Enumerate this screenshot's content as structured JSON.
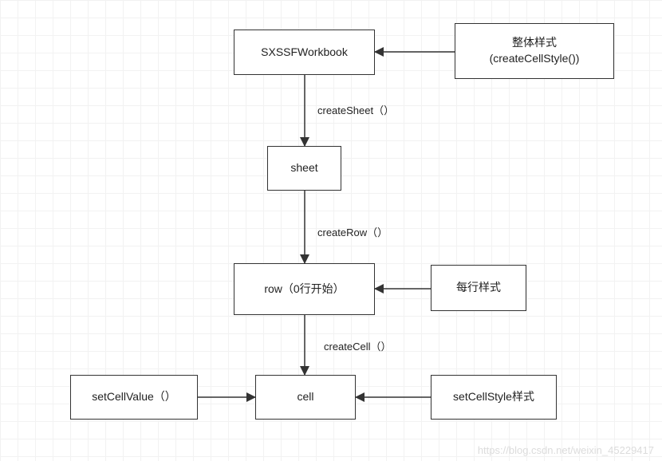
{
  "nodes": {
    "workbook": {
      "label": "SXSSFWorkbook"
    },
    "globalStyle": {
      "label": "整体样式\n(createCellStyle())"
    },
    "sheet": {
      "label": "sheet"
    },
    "row": {
      "label": "row（0行开始）"
    },
    "rowStyle": {
      "label": "每行样式"
    },
    "cell": {
      "label": "cell"
    },
    "setValue": {
      "label": "setCellValue（）"
    },
    "setStyle": {
      "label": "setCellStyle样式"
    }
  },
  "edges": {
    "createSheet": {
      "label": "createSheet（）"
    },
    "createRow": {
      "label": "createRow（）"
    },
    "createCell": {
      "label": "createCell（）"
    }
  },
  "watermark": "https://blog.csdn.net/weixin_45229417"
}
